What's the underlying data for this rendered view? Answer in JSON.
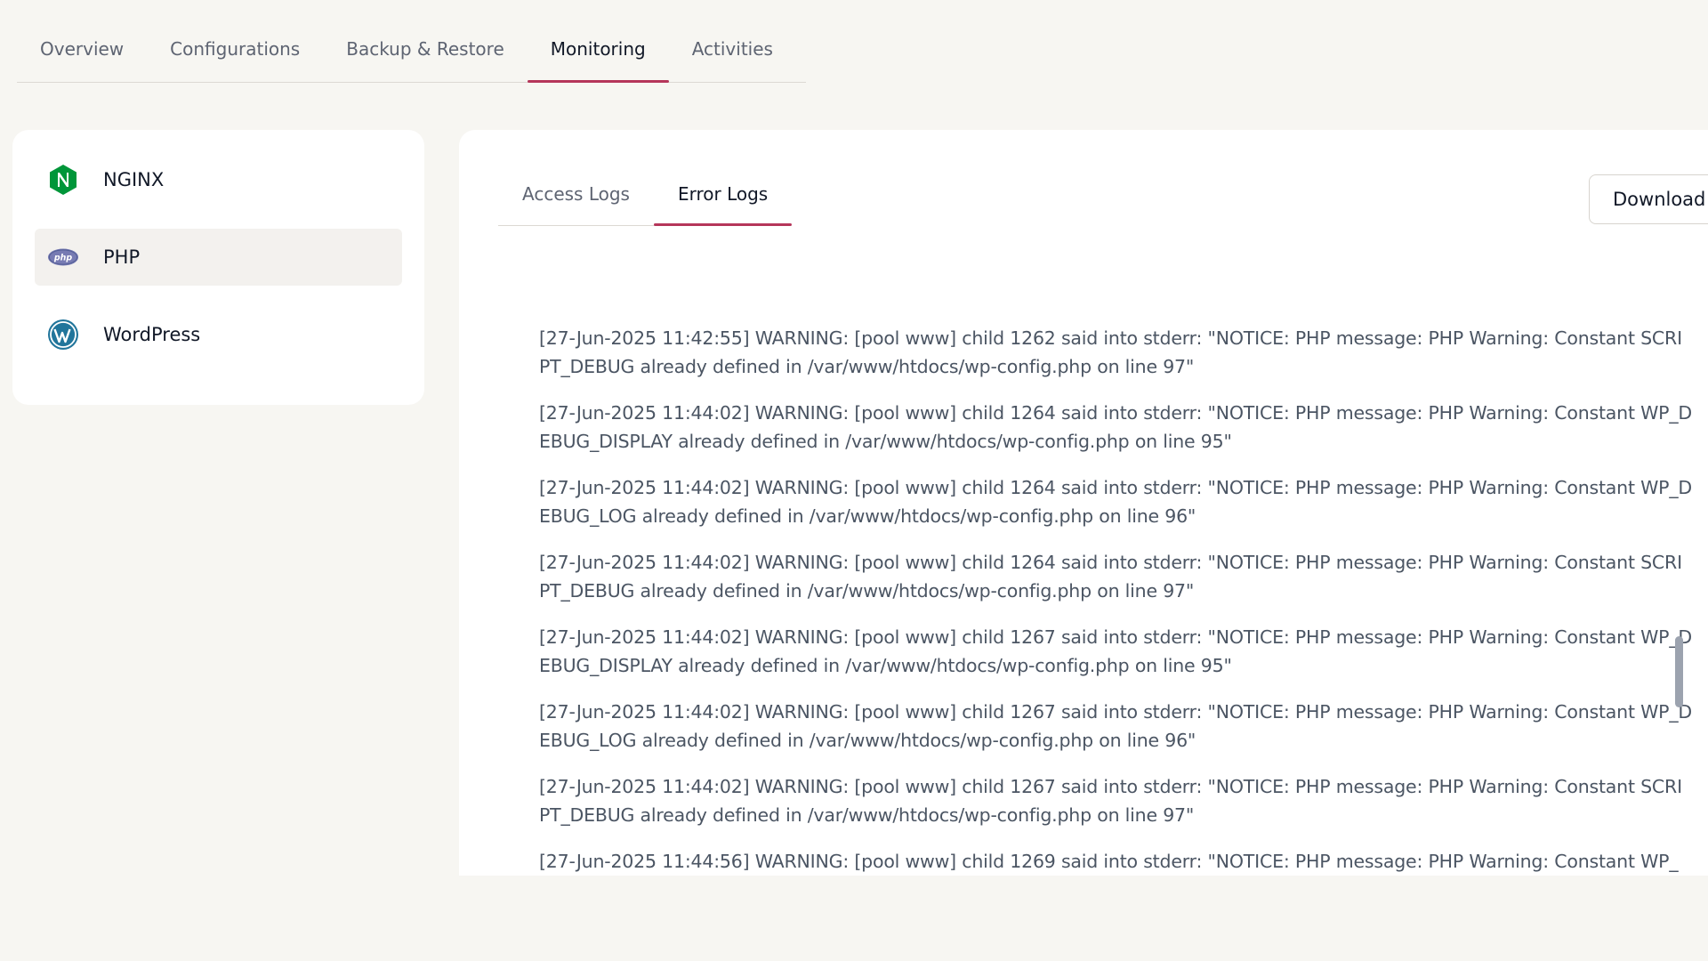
{
  "top_tabs": [
    "Overview",
    "Configurations",
    "Backup & Restore",
    "Monitoring",
    "Activities"
  ],
  "active_top_tab": "Monitoring",
  "sidebar": {
    "items": [
      {
        "label": "NGINX",
        "icon": "nginx-icon",
        "active": false
      },
      {
        "label": "PHP",
        "icon": "php-icon",
        "active": true
      },
      {
        "label": "WordPress",
        "icon": "wordpress-icon",
        "active": false
      }
    ]
  },
  "log_tabs": [
    "Access Logs",
    "Error Logs"
  ],
  "active_log_tab": "Error Logs",
  "download_label": "Download",
  "logs": [
    "[27-Jun-2025 11:42:55] WARNING: [pool www] child 1262 said into stderr: \"NOTICE: PHP message: PHP Warning:  Constant SCRIPT_DEBUG already defined in /var/www/htdocs/wp-config.php on line 97\"",
    "[27-Jun-2025 11:44:02] WARNING: [pool www] child 1264 said into stderr: \"NOTICE: PHP message: PHP Warning:  Constant WP_DEBUG_DISPLAY already defined in /var/www/htdocs/wp-config.php on line 95\"",
    "[27-Jun-2025 11:44:02] WARNING: [pool www] child 1264 said into stderr: \"NOTICE: PHP message: PHP Warning:  Constant WP_DEBUG_LOG already defined in /var/www/htdocs/wp-config.php on line 96\"",
    "[27-Jun-2025 11:44:02] WARNING: [pool www] child 1264 said into stderr: \"NOTICE: PHP message: PHP Warning:  Constant SCRIPT_DEBUG already defined in /var/www/htdocs/wp-config.php on line 97\"",
    "[27-Jun-2025 11:44:02] WARNING: [pool www] child 1267 said into stderr: \"NOTICE: PHP message: PHP Warning:  Constant WP_DEBUG_DISPLAY already defined in /var/www/htdocs/wp-config.php on line 95\"",
    "[27-Jun-2025 11:44:02] WARNING: [pool www] child 1267 said into stderr: \"NOTICE: PHP message: PHP Warning:  Constant WP_DEBUG_LOG already defined in /var/www/htdocs/wp-config.php on line 96\"",
    "[27-Jun-2025 11:44:02] WARNING: [pool www] child 1267 said into stderr: \"NOTICE: PHP message: PHP Warning:  Constant SCRIPT_DEBUG already defined in /var/www/htdocs/wp-config.php on line 97\"",
    "[27-Jun-2025 11:44:56] WARNING: [pool www] child 1269 said into stderr: \"NOTICE: PHP message: PHP Warning:  Constant WP_"
  ],
  "colors": {
    "accent": "#b5365a",
    "nginx": "#009639",
    "php": "#777bb3",
    "wordpress": "#21759b"
  }
}
